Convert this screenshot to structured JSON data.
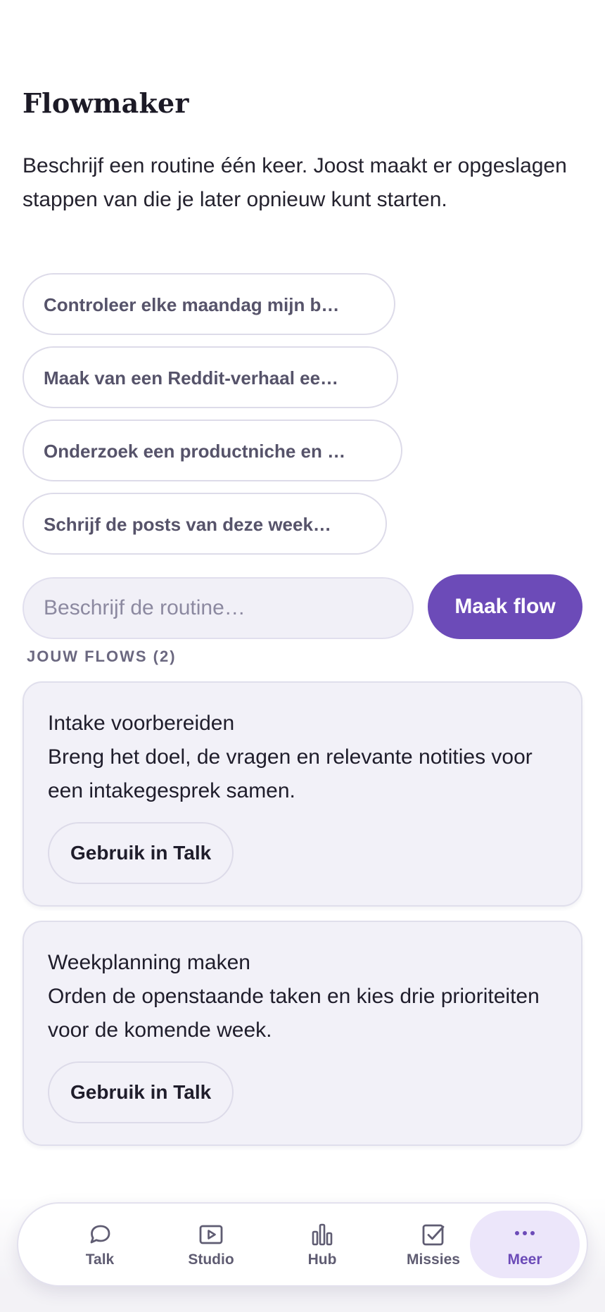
{
  "header": {
    "title": "Flowmaker",
    "intro": "Beschrijf een routine één keer. Joost maakt er opgeslagen stappen van die je later opnieuw kunt starten."
  },
  "suggestions": [
    "Controleer elke maandag mijn b…",
    "Maak van een Reddit-verhaal ee…",
    "Onderzoek een productniche en …",
    "Schrijf de posts van deze week…"
  ],
  "composer": {
    "placeholder": "Beschrijf de routine…",
    "value": "",
    "button_label": "Maak flow"
  },
  "flows_section": {
    "label": "JOUW FLOWS (2)"
  },
  "flows": [
    {
      "name": "Intake voorbereiden",
      "description": "Breng het doel, de vragen en relevante notities voor een intakegesprek samen.",
      "action_label": "Gebruik in Talk"
    },
    {
      "name": "Weekplanning maken",
      "description": "Orden de openstaande taken en kies drie prioriteiten voor de komende week.",
      "action_label": "Gebruik in Talk"
    }
  ],
  "nav": {
    "items": [
      {
        "label": "Talk",
        "icon": "chat-bubble-icon",
        "active": false
      },
      {
        "label": "Studio",
        "icon": "play-video-icon",
        "active": false
      },
      {
        "label": "Hub",
        "icon": "bar-chart-icon",
        "active": false
      },
      {
        "label": "Missies",
        "icon": "checkbox-icon",
        "active": false
      },
      {
        "label": "Meer",
        "icon": "more-dots-icon",
        "active": true
      }
    ]
  },
  "colors": {
    "accent": "#6c4bb8",
    "accent_soft": "#ece6fa",
    "card_background": "#f2f1f8",
    "muted_text": "#6b6880"
  }
}
